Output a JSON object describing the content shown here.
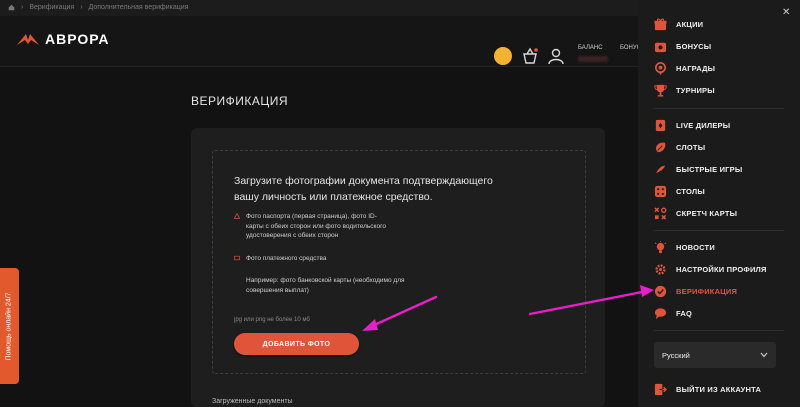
{
  "breadcrumb": {
    "items": [
      "Верификация",
      "Дополнительная верификация"
    ]
  },
  "header": {
    "brand": "АВРОРА",
    "balance_label": "БАЛАНС",
    "bonus_label": "БОНУС"
  },
  "main": {
    "title": "ВЕРИФИКАЦИЯ",
    "upload_heading": "Загрузите фотографии документа подтверждающего вашу личность или платежное средство.",
    "requirement_1": "Фото паспорта (первая страница), фото ID-карты с обеих сторон или фото водительского удостоверения с обеих сторон",
    "requirement_2": "Фото платежного средства",
    "example": "Например: фото банковской карты (необходимо для совершения выплат)",
    "formats": "jpg или png не более 10 мб",
    "add_photo_button": "ДОБАВИТЬ ФОТО",
    "uploaded_label": "Загруженные документы"
  },
  "help_tab": "Помощь онлайн 24/7",
  "menu": {
    "group1": [
      {
        "label": "АКЦИИ",
        "icon": "gift-icon"
      },
      {
        "label": "БОНУСЫ",
        "icon": "bonus-icon"
      },
      {
        "label": "НАГРАДЫ",
        "icon": "medal-icon"
      },
      {
        "label": "ТУРНИРЫ",
        "icon": "trophy-icon"
      }
    ],
    "group2": [
      {
        "label": "LIVE ДИЛЕРЫ",
        "icon": "cards-icon"
      },
      {
        "label": "СЛОТЫ",
        "icon": "slots-icon"
      },
      {
        "label": "БЫСТРЫЕ ИГРЫ",
        "icon": "bolt-icon"
      },
      {
        "label": "СТОЛЫ",
        "icon": "dice-icon"
      },
      {
        "label": "СКРЕТЧ КАРТЫ",
        "icon": "scratch-icon"
      }
    ],
    "group3": [
      {
        "label": "НОВОСТИ",
        "icon": "bulb-icon"
      },
      {
        "label": "НАСТРОЙКИ ПРОФИЛЯ",
        "icon": "gear-icon"
      },
      {
        "label": "ВЕРИФИКАЦИЯ",
        "icon": "check-icon"
      },
      {
        "label": "FAQ",
        "icon": "chat-icon"
      }
    ],
    "language": "Русский",
    "logout": "ВЫЙТИ ИЗ АККАУНТА"
  },
  "colors": {
    "accent": "#e0553a",
    "annotation_arrow": "#e81fc8"
  }
}
